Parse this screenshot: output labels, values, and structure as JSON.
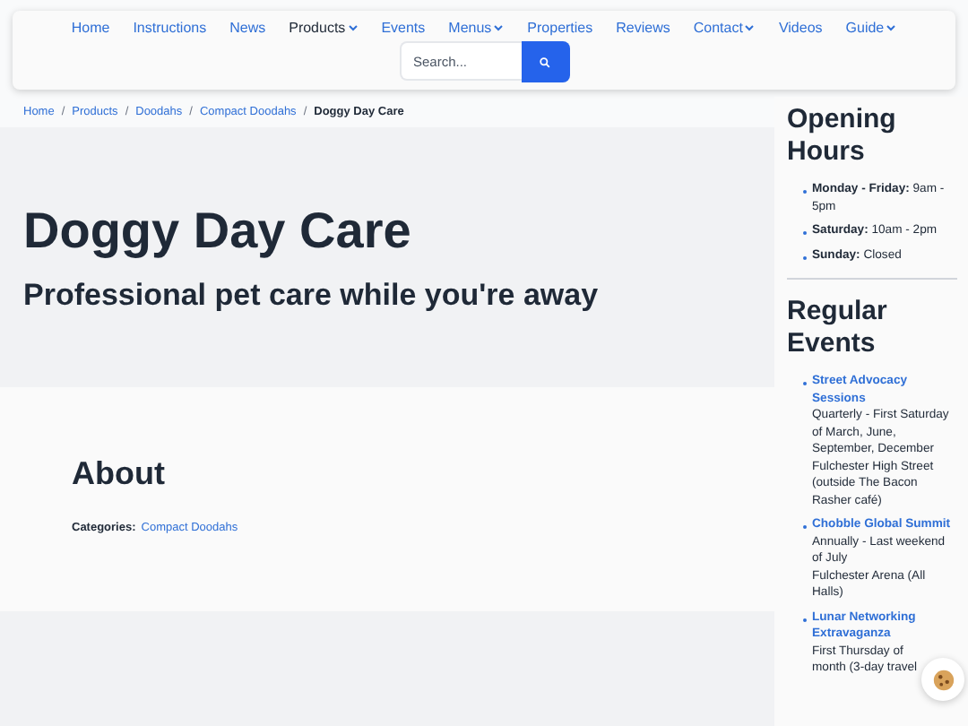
{
  "nav": {
    "items": [
      {
        "label": "Home",
        "dropdown": false,
        "selected": false
      },
      {
        "label": "Instructions",
        "dropdown": false,
        "selected": false
      },
      {
        "label": "News",
        "dropdown": false,
        "selected": false
      },
      {
        "label": "Products",
        "dropdown": true,
        "selected": true
      },
      {
        "label": "Events",
        "dropdown": false,
        "selected": false
      },
      {
        "label": "Menus",
        "dropdown": true,
        "selected": false
      },
      {
        "label": "Properties",
        "dropdown": false,
        "selected": false
      },
      {
        "label": "Reviews",
        "dropdown": false,
        "selected": false
      },
      {
        "label": "Contact",
        "dropdown": true,
        "selected": false
      },
      {
        "label": "Videos",
        "dropdown": false,
        "selected": false
      },
      {
        "label": "Guide",
        "dropdown": true,
        "selected": false
      }
    ],
    "search": {
      "placeholder": "Search..."
    }
  },
  "breadcrumb": {
    "links": [
      "Home",
      "Products",
      "Doodahs",
      "Compact Doodahs"
    ],
    "separator": "/",
    "current": "Doggy Day Care"
  },
  "hero": {
    "title": "Doggy Day Care",
    "subtitle": "Professional pet care while you're away"
  },
  "about": {
    "heading": "About",
    "categories_label": "Categories:",
    "categories": [
      "Compact Doodahs"
    ]
  },
  "sidebar": {
    "hours": {
      "heading": "Opening Hours",
      "items": [
        "**Monday - Friday:** 9am - 5pm",
        "**Saturday:** 10am - 2pm",
        "**Sunday:** Closed"
      ]
    },
    "events": {
      "heading": "Regular Events",
      "items": [
        {
          "title": "Street Advocacy Sessions",
          "lines": [
            "Quarterly - First Saturday of March, June, September, December",
            "Fulchester High Street (outside The Bacon Rasher café)"
          ]
        },
        {
          "title": "Chobble Global Summit",
          "lines": [
            "Annually - Last weekend of July",
            "Fulchester Arena (All Halls)"
          ]
        },
        {
          "title": "Lunar Networking Extravaganza",
          "lines": [
            "First Thursday of",
            "month (3-day travel"
          ]
        }
      ]
    }
  }
}
